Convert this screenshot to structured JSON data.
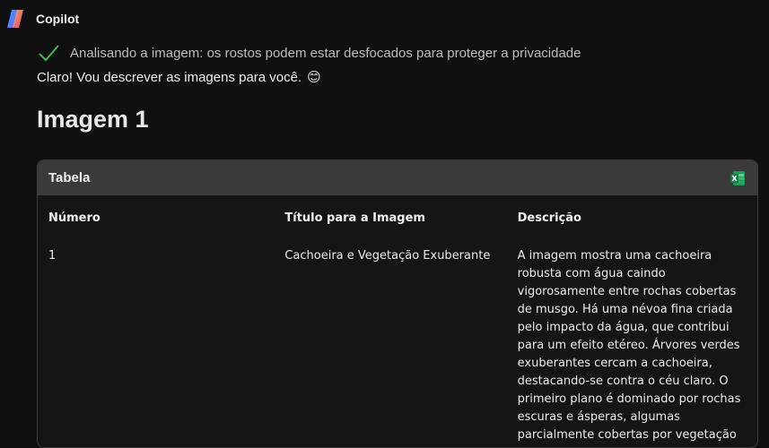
{
  "app": {
    "name": "Copilot"
  },
  "status": {
    "text": "Analisando a imagem: os rostos podem estar desfocados para proteger a privacidade"
  },
  "intro": {
    "text": "Claro! Vou descrever as imagens para você.",
    "emoji": "😊"
  },
  "heading": {
    "text": "Imagem 1"
  },
  "table": {
    "title": "Tabela",
    "export_icon": "excel-icon",
    "columns": [
      "Número",
      "Título para a Imagem",
      "Descrição"
    ],
    "rows": [
      [
        "1",
        "Cachoeira e Vegetação Exuberante",
        "A imagem mostra uma cachoeira robusta com água caindo vigorosamente entre rochas cobertas de musgo. Há uma névoa fina criada pelo impacto da água, que contribui para um efeito etéreo. Árvores verdes exuberantes cercam a cachoeira, destacando-se contra o céu claro. O primeiro plano é dominado por rochas escuras e ásperas, algumas parcialmente cobertas por vegetação"
      ]
    ]
  },
  "colors": {
    "background": "#101010",
    "table_header": "#3a3a3a",
    "check": "#3fb950"
  }
}
